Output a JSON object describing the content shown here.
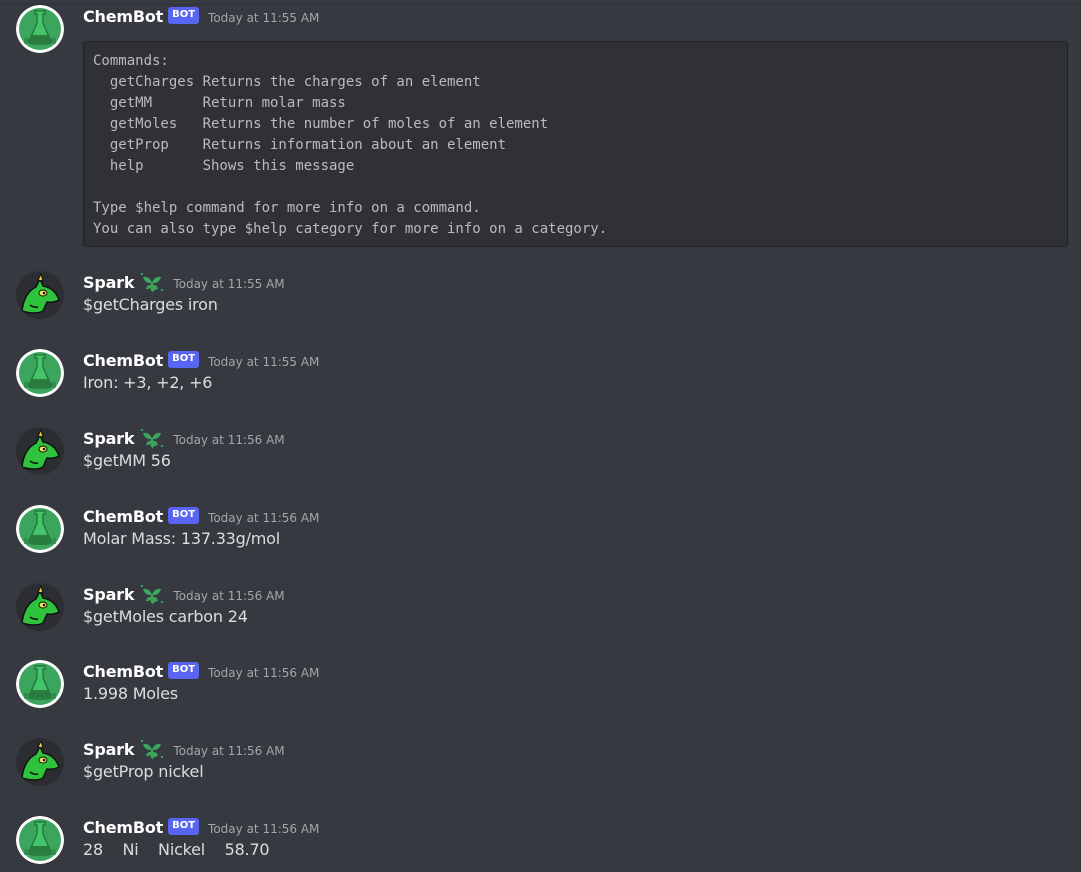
{
  "users": {
    "chembot": {
      "name": "ChemBot",
      "tag": "BOT",
      "avatar_icon": "flask-icon"
    },
    "spark": {
      "name": "Spark",
      "badge_icon": "sprout-icon",
      "avatar_icon": "dragon-icon"
    }
  },
  "messages": [
    {
      "author": "ChemBot",
      "tag": "BOT",
      "time": "Today at 11:55 AM",
      "code": "Commands:\n  getCharges Returns the charges of an element\n  getMM      Return molar mass\n  getMoles   Returns the number of moles of an element\n  getProp    Returns information about an element\n  help       Shows this message\n\nType $help command for more info on a command.\nYou can also type $help category for more info on a category."
    },
    {
      "author": "Spark",
      "time": "Today at 11:55 AM",
      "text": "$getCharges iron"
    },
    {
      "author": "ChemBot",
      "tag": "BOT",
      "time": "Today at 11:55 AM",
      "text": "Iron: +3, +2, +6"
    },
    {
      "author": "Spark",
      "time": "Today at 11:56 AM",
      "text": "$getMM 56"
    },
    {
      "author": "ChemBot",
      "tag": "BOT",
      "time": "Today at 11:56 AM",
      "text": "Molar Mass: 137.33g/mol"
    },
    {
      "author": "Spark",
      "time": "Today at 11:56 AM",
      "text": "$getMoles carbon 24"
    },
    {
      "author": "ChemBot",
      "tag": "BOT",
      "time": "Today at 11:56 AM",
      "text": "1.998 Moles"
    },
    {
      "author": "Spark",
      "time": "Today at 11:56 AM",
      "text": "$getProp nickel"
    },
    {
      "author": "ChemBot",
      "tag": "BOT",
      "time": "Today at 11:56 AM",
      "text": "28    Ni    Nickel    58.70"
    }
  ],
  "colors": {
    "background": "#36393f",
    "codeblock_bg": "#2f3136",
    "bot_tag": "#5865f2",
    "flask_green": "#3ba55d",
    "dragon_green": "#2fc23d",
    "sprout_green": "#3ba55d"
  }
}
